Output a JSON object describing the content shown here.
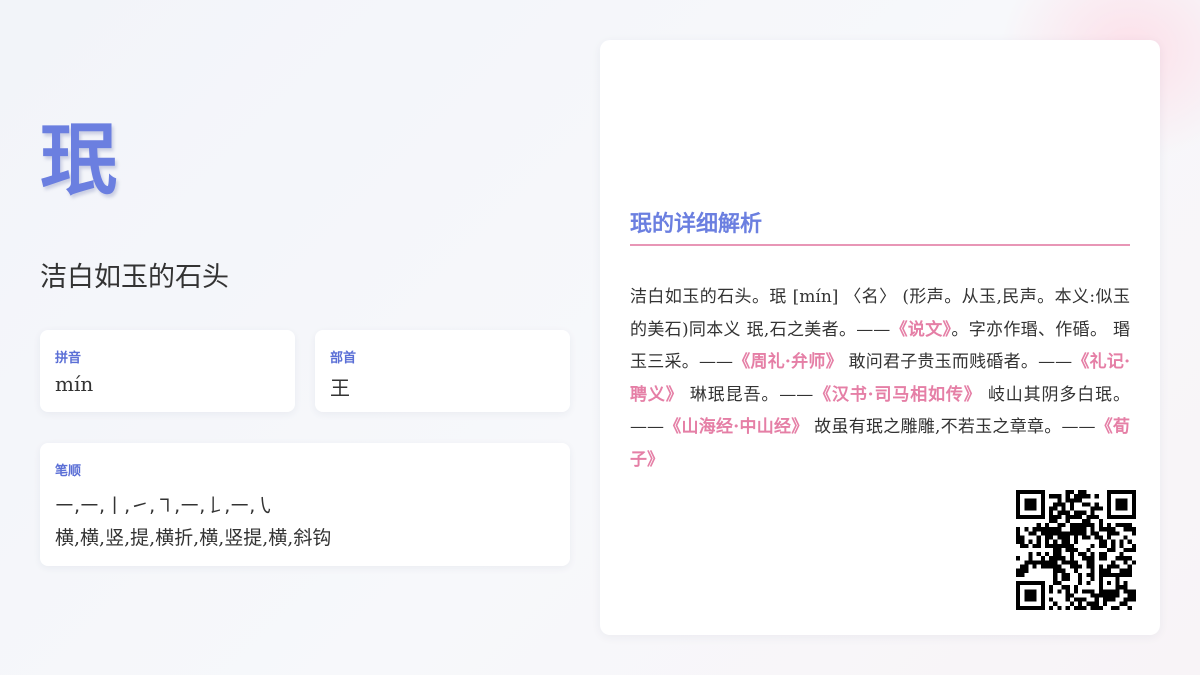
{
  "character": "珉",
  "meaning": "洁白如玉的石头",
  "pinyin": {
    "label": "拼音",
    "value": "mín"
  },
  "radical": {
    "label": "部首",
    "value": "王"
  },
  "strokes": {
    "label": "笔顺",
    "symbols": "㇐,㇐,丨,㇀,㇕,㇐,𠄌,㇐,㇂",
    "names": "横,横,竖,提,横折,横,竖提,横,斜钩"
  },
  "detail": {
    "title": "珉的详细解析",
    "segments": [
      {
        "text": "洁白如玉的石头。珉 [mín] 〈名〉 (形声。从玉,民声。本义:似玉的美石)同本义 珉,石之美者。——",
        "cite": false
      },
      {
        "text": "《说文》",
        "cite": true
      },
      {
        "text": "。字亦作瑉、作碈。 瑉玉三采。——",
        "cite": false
      },
      {
        "text": "《周礼·弁师》",
        "cite": true
      },
      {
        "text": " 敢问君子贵玉而贱碈者。——",
        "cite": false
      },
      {
        "text": "《礼记·聘义》",
        "cite": true
      },
      {
        "text": " 琳珉昆吾。——",
        "cite": false
      },
      {
        "text": "《汉书·司马相如传》",
        "cite": true
      },
      {
        "text": " 岐山其阴多白珉。——",
        "cite": false
      },
      {
        "text": "《山海经·中山经》",
        "cite": true
      },
      {
        "text": " 故虽有珉之雕雕,不若玉之章章。——",
        "cite": false
      },
      {
        "text": "《荀子》",
        "cite": true
      }
    ]
  },
  "colors": {
    "accent": "#6b7fe0",
    "citation": "#e57fa6",
    "rule": "#e896b6"
  },
  "qr_icon": "qr-code-icon"
}
